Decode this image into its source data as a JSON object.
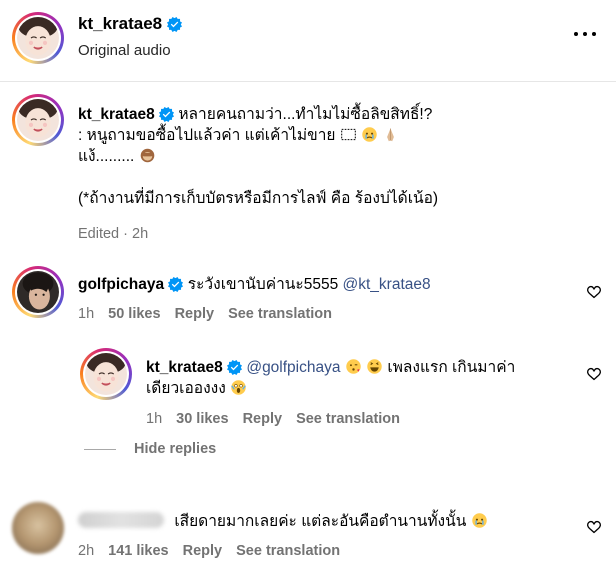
{
  "header": {
    "username": "kt_kratae8",
    "subtitle": "Original audio",
    "more_icon": "more-horizontal-icon"
  },
  "caption": {
    "username": "kt_kratae8",
    "line1": "หลายคนถามว่า...ทำไมไม่ซื้อลิขสิทธิ์!?",
    "line2": ": หนูถามขอซื้อไปแล้วค่า แต่เค้าไม่ขาย",
    "line3": "แง้.........",
    "line4": "(*ถ้างานที่มีการเก็บบัตรหรือมีการไลฟ์ คือ ร้องบ่ได้เน้อ)",
    "meta": "Edited · 2h"
  },
  "comments": [
    {
      "username": "golfpichaya",
      "text": "ระวังเขานับค่านะ5555",
      "mention": "@kt_kratae8",
      "time": "1h",
      "likes": "50 likes",
      "reply": "Reply",
      "translate": "See translation"
    },
    {
      "username": "kt_kratae8",
      "mention": "@golfpichaya",
      "text_a": "เพลงแรก เกินมาค่า",
      "text_b": "เดียวเอองงง",
      "time": "1h",
      "likes": "30 likes",
      "reply": "Reply",
      "translate": "See translation"
    },
    {
      "text": "เสียดายมากเลยค่ะ แต่ละอันคือตำนานทั้งนั้น",
      "time": "2h",
      "likes": "141 likes",
      "reply": "Reply",
      "translate": "See translation"
    }
  ],
  "hide_replies": "Hide replies",
  "colors": {
    "verified": "#0095f6",
    "muted": "#737373",
    "mention": "#385185"
  }
}
